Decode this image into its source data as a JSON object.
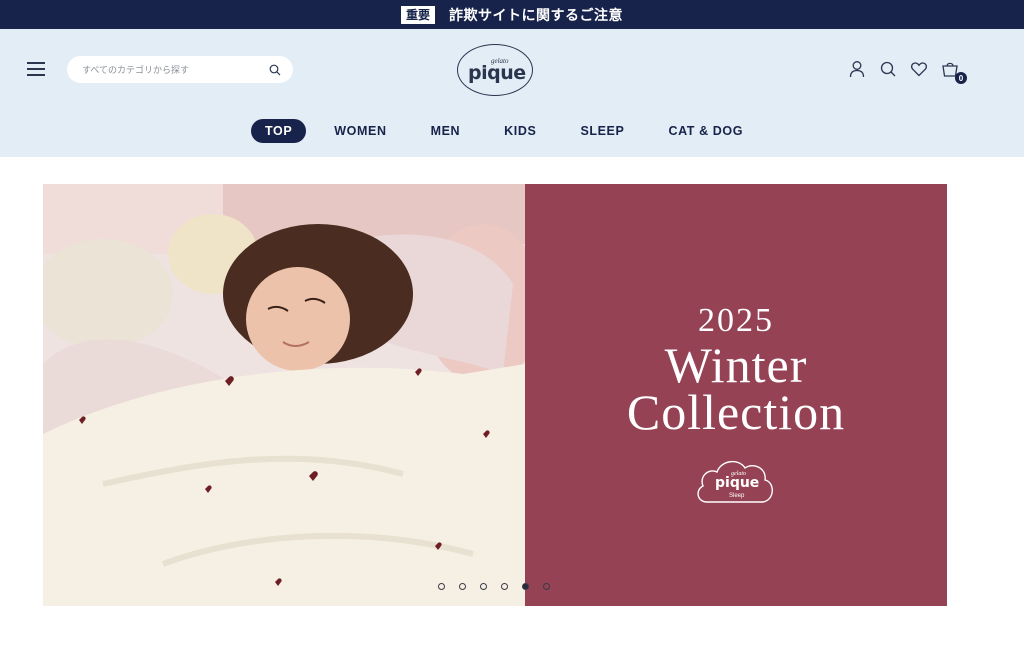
{
  "notice": {
    "badge": "重要",
    "message": "詐欺サイトに関するご注意"
  },
  "header": {
    "search": {
      "placeholder": "すべてのカテゴリから探す"
    },
    "logo": {
      "small": "gelato",
      "big": "pique"
    },
    "icons": [
      "account-icon",
      "search-icon",
      "heart-icon",
      "cart-icon"
    ],
    "cart_count": "0"
  },
  "nav": {
    "tabs": [
      {
        "label": "TOP",
        "active": true
      },
      {
        "label": "WOMEN"
      },
      {
        "label": "MEN"
      },
      {
        "label": "KIDS"
      },
      {
        "label": "SLEEP"
      },
      {
        "label": "CAT & DOG"
      }
    ]
  },
  "hero": {
    "year": "2025",
    "title_line1": "Winter",
    "title_line2": "Collection",
    "badge": {
      "small": "gelato",
      "big": "pique",
      "sub": "Sleep"
    },
    "panel_color": "#954255",
    "slides": 6,
    "active_slide": 5
  },
  "colors": {
    "navy": "#17234a",
    "header_bg": "#e3edf5",
    "panel": "#954255"
  }
}
